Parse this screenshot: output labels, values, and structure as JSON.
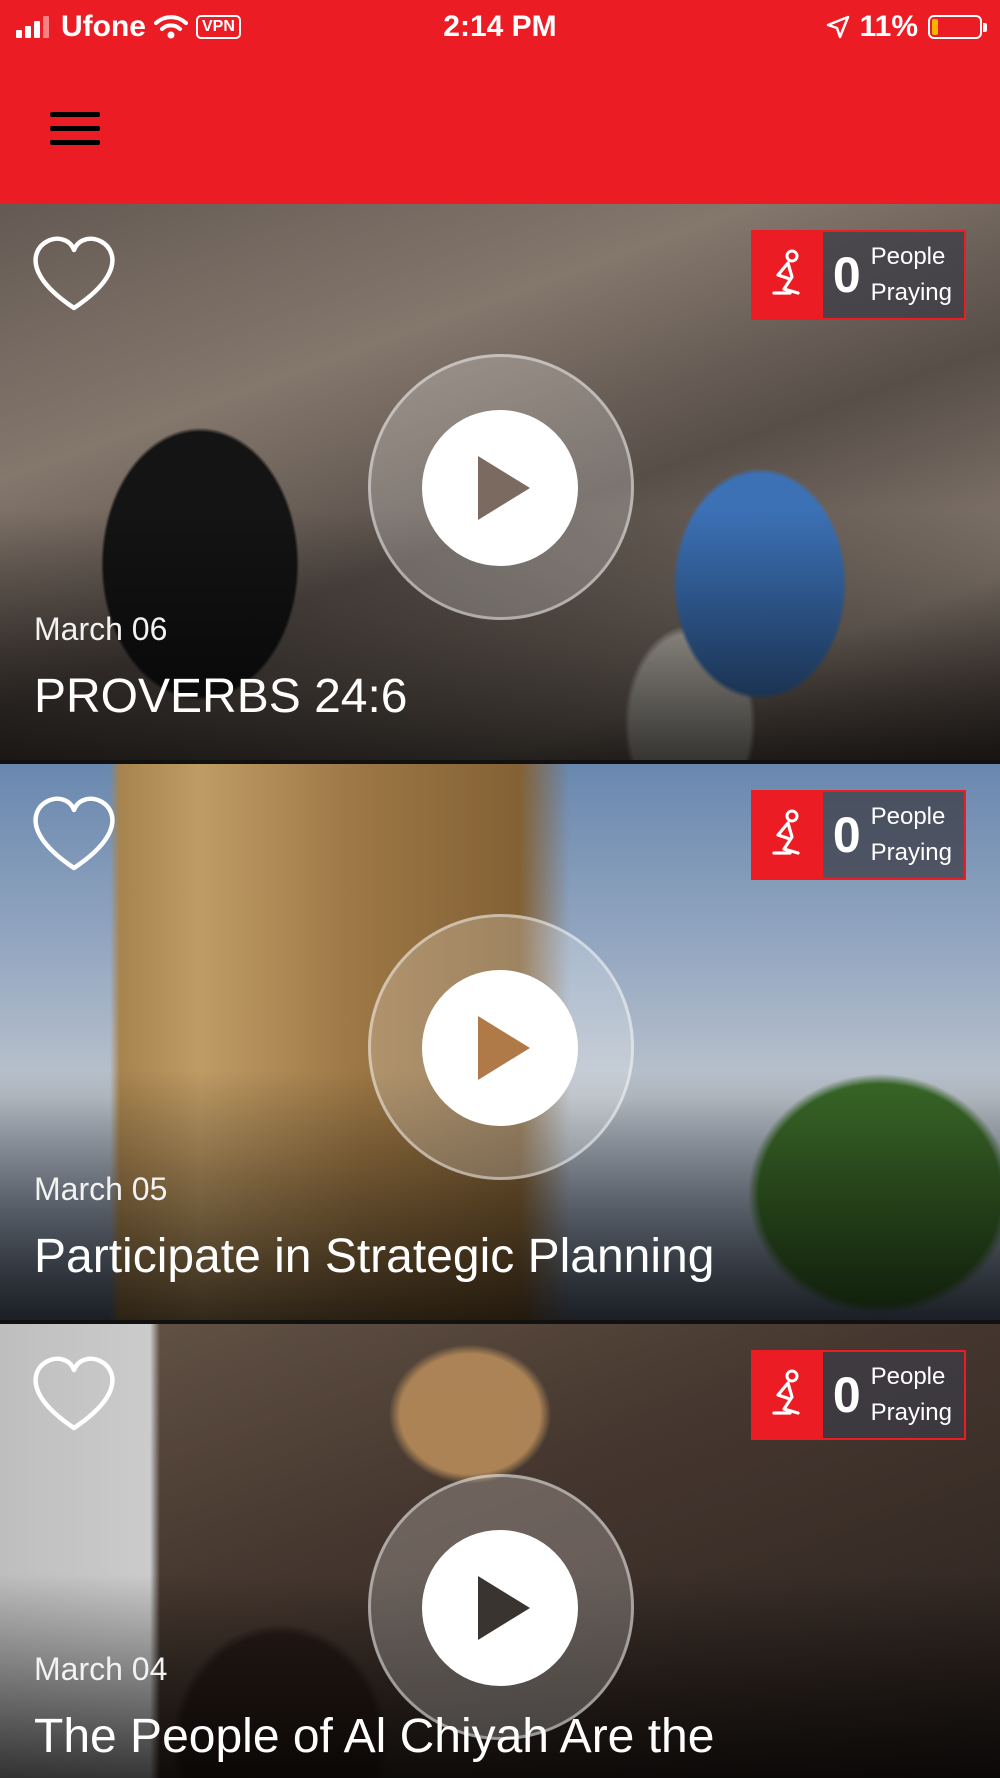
{
  "status_bar": {
    "carrier": "Ufone",
    "vpn": "VPN",
    "time": "2:14 PM",
    "battery": "11%",
    "battery_level": 0.11
  },
  "app_bar": {
    "menu_icon": "hamburger-menu-icon",
    "background": "#ec1c24"
  },
  "cards": [
    {
      "date": "March 06",
      "title": "PROVERBS 24:6",
      "praying_count": "0",
      "praying_label_1": "People",
      "praying_label_2": "Praying"
    },
    {
      "date": "March 05",
      "title": "Participate in Strategic Planning",
      "praying_count": "0",
      "praying_label_1": "People",
      "praying_label_2": "Praying"
    },
    {
      "date": "March 04",
      "title": "The People of Al Chiyah Are the",
      "praying_count": "0",
      "praying_label_1": "People",
      "praying_label_2": "Praying"
    }
  ],
  "colors": {
    "accent": "#ec1c24",
    "text": "#ffffff"
  }
}
